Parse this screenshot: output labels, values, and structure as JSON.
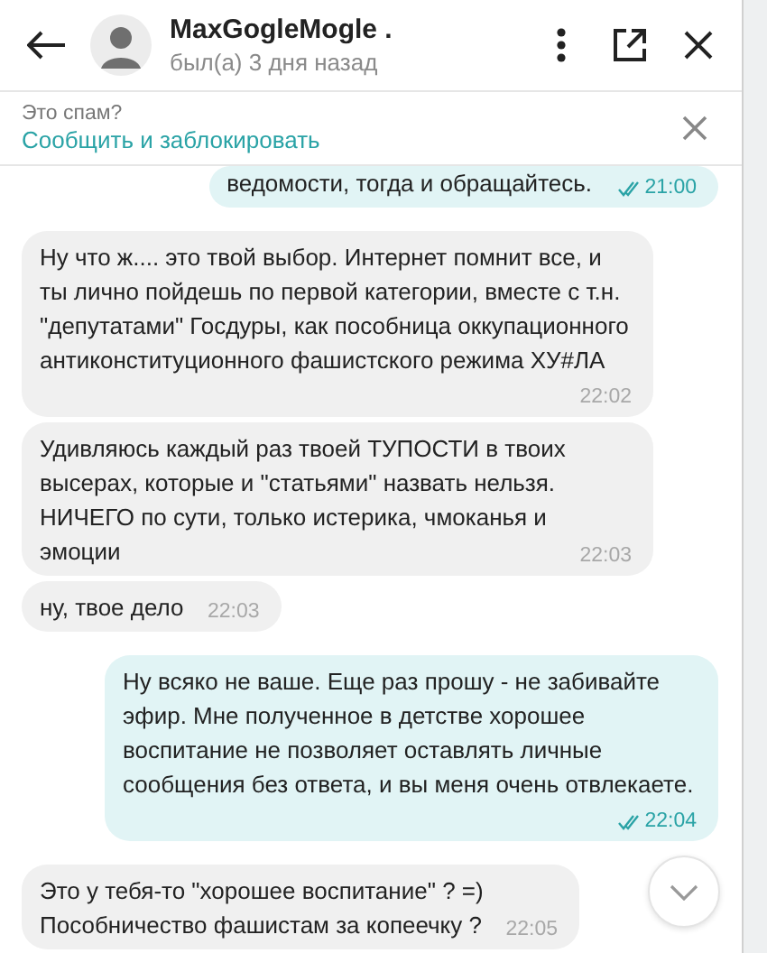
{
  "header": {
    "name": "MaxGogleMogle .",
    "status": "был(а) 3 дня назад"
  },
  "spam_banner": {
    "question": "Это спам?",
    "action": "Сообщить и заблокировать"
  },
  "messages": [
    {
      "kind": "out",
      "text": "ведомости, тогда и обращайтесь.",
      "time": "21:00",
      "read": true
    },
    {
      "kind": "in",
      "text": "Ну что ж.... это твой выбор. Интернет помнит все, и ты лично пойдешь по первой категории, вместе с т.н. \"депутатами\" Госдуры, как пособница оккупационного антиконституционного фашистского режима ХУ#ЛА",
      "time": "22:02"
    },
    {
      "kind": "in",
      "text": "Удивляюсь каждый раз твоей ТУПОСТИ в твоих высерах, которые и \"статьями\" назвать нельзя. НИЧЕГО по сути, только истерика, чмоканья и эмоции",
      "time": "22:03"
    },
    {
      "kind": "in",
      "text": "ну, твое дело",
      "time": "22:03"
    },
    {
      "kind": "out",
      "text": "Ну всяко не ваше. Еще раз прошу - не забивайте эфир. Мне полученное в детстве хорошее воспитание не позволяет оставлять личные сообщения без ответа, и вы меня очень отвлекаете.",
      "time": "22:04",
      "read": true
    },
    {
      "kind": "in",
      "text": "Это у тебя-то \"хорошее воспитание\" ? =)\nПособничество фашистам за копеечку ?",
      "time": "22:05"
    }
  ]
}
